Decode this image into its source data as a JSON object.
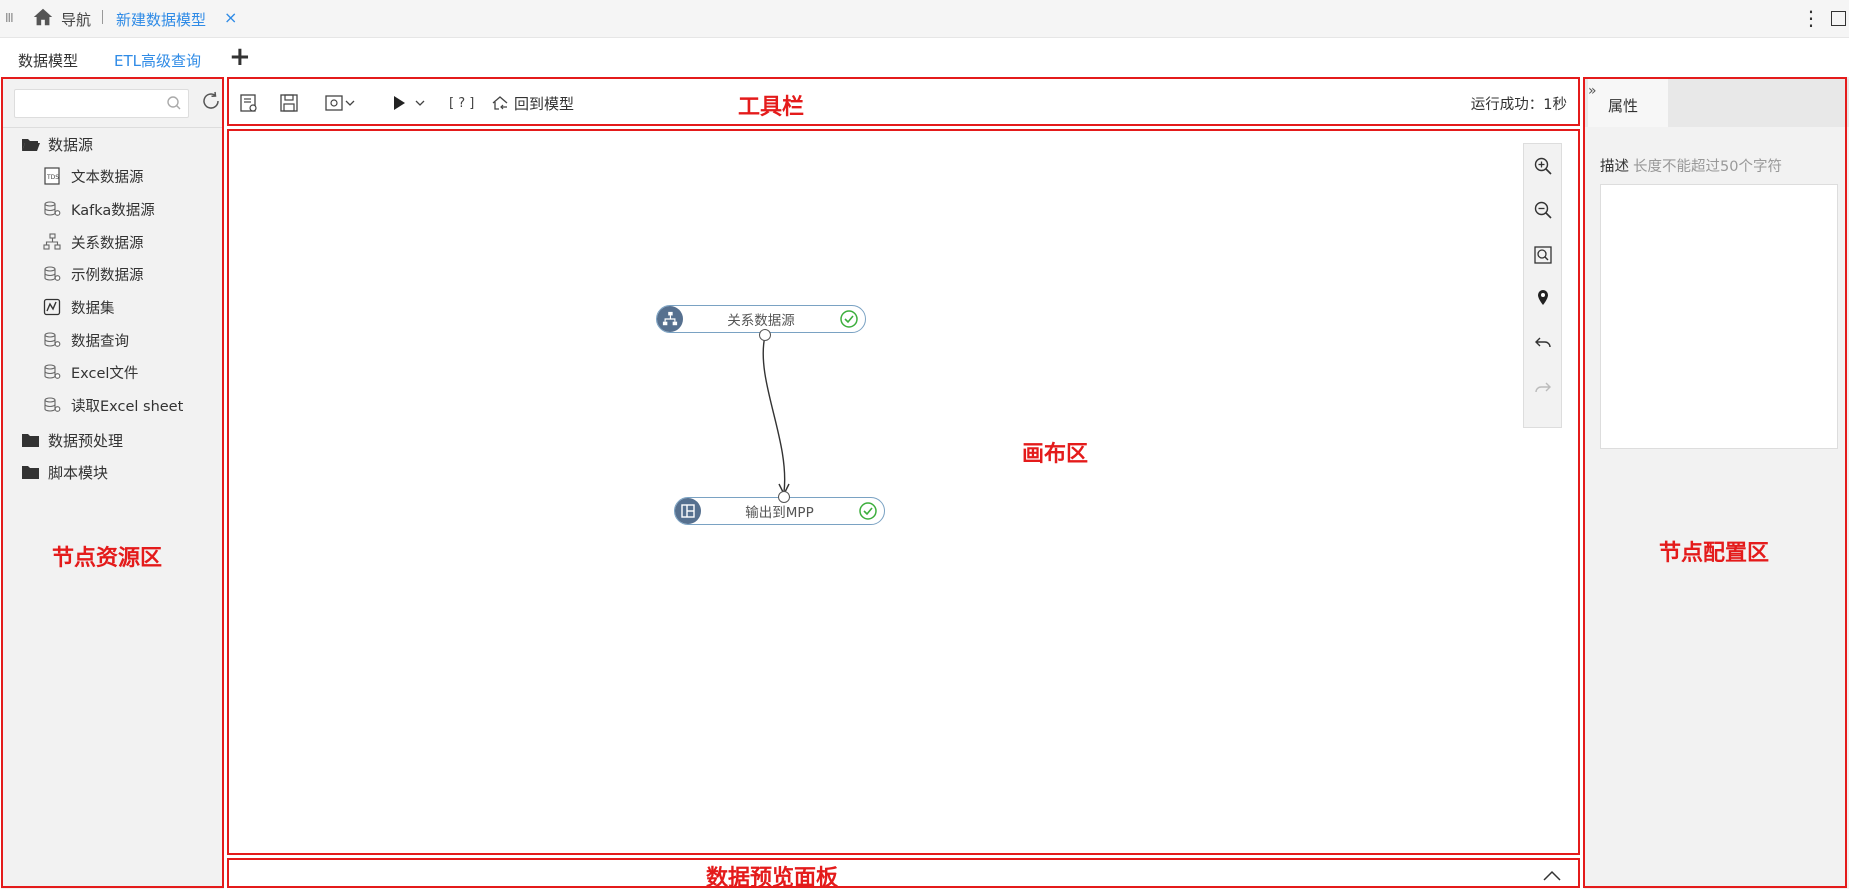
{
  "topbar": {
    "grip": "III",
    "nav_label": "导航",
    "active_tab": "新建数据模型",
    "close": "×",
    "more": "⋮"
  },
  "tabs2": {
    "tab1": "数据模型",
    "tab2": "ETL高级查询",
    "add": "+"
  },
  "left": {
    "search_placeholder": "",
    "folders": [
      {
        "label": "数据源",
        "open": true
      },
      {
        "label": "数据预处理",
        "open": false
      },
      {
        "label": "脚本模块",
        "open": false
      }
    ],
    "items": [
      {
        "label": "文本数据源",
        "icon": "text-datasource-icon"
      },
      {
        "label": "Kafka数据源",
        "icon": "database-icon"
      },
      {
        "label": "关系数据源",
        "icon": "relational-icon"
      },
      {
        "label": "示例数据源",
        "icon": "database-icon"
      },
      {
        "label": "数据集",
        "icon": "dataset-icon"
      },
      {
        "label": "数据查询",
        "icon": "database-icon"
      },
      {
        "label": "Excel文件",
        "icon": "database-icon"
      },
      {
        "label": "读取Excel sheet",
        "icon": "database-icon"
      }
    ]
  },
  "toolbar": {
    "back_label": "回到模型",
    "help": "[ ? ]",
    "status": "运行成功：1秒"
  },
  "canvas": {
    "nodes": [
      {
        "label": "关系数据源",
        "status": "success"
      },
      {
        "label": "输出到MPP",
        "status": "success"
      }
    ]
  },
  "right": {
    "tab": "属性",
    "collapse": "»",
    "desc_label": "描述",
    "desc_hint": "长度不能超过50个字符",
    "desc_value": ""
  },
  "annotations": {
    "toolbar": "工具栏",
    "canvas": "画布区",
    "resources": "节点资源区",
    "config": "节点配置区",
    "preview": "数据预览面板"
  },
  "colors": {
    "accent": "#2f8be6",
    "annotation": "#e41b1b",
    "node_icon_bg": "#56708f",
    "success": "#3cae3c"
  }
}
